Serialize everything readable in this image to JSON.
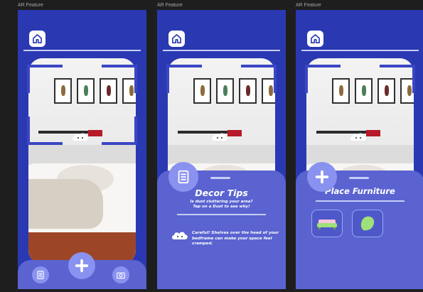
{
  "frames": [
    {
      "label": "AR Feature"
    },
    {
      "label": "AR Feature"
    },
    {
      "label": "AR Feature"
    }
  ],
  "decor_tips": {
    "title": "Decor Tips",
    "subtitle_line1": "Is dust cluttering your area?",
    "subtitle_line2": "Tap on a Dust to see why!",
    "tip": "Careful! Shelves over the head of your bedframe can make your space feel cramped."
  },
  "place_furniture": {
    "title": "Place Furniture",
    "items": [
      {
        "icon": "sofa-icon"
      },
      {
        "icon": "chair-icon"
      }
    ]
  },
  "colors": {
    "primary": "#2a39b2",
    "sheet": "#5a63d0",
    "accent": "#8a92f0"
  }
}
